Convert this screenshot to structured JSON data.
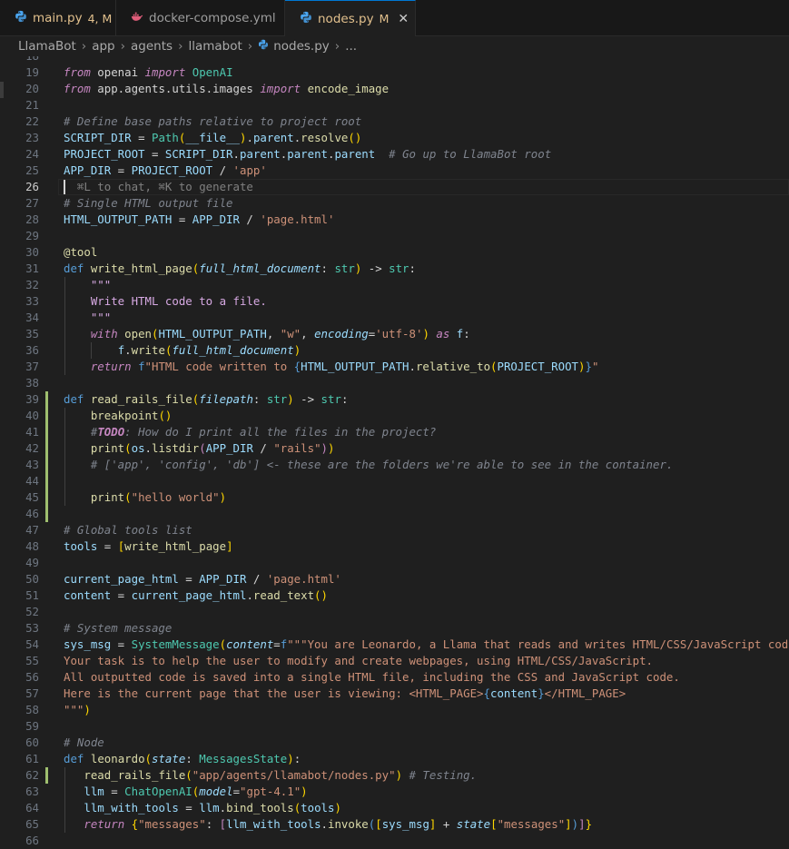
{
  "tabs": [
    {
      "name": "main.py",
      "badge": "4, M",
      "icon": "python-file-icon",
      "color": "#4aa5f0",
      "label_color": "#e2c08d",
      "active": false
    },
    {
      "name": "docker-compose.yml",
      "badge": "",
      "icon": "docker-file-icon",
      "color": "#e05d7a",
      "label_color": "#9d9d9d",
      "active": false
    },
    {
      "name": "nodes.py",
      "badge": "M",
      "icon": "python-file-icon",
      "color": "#4aa5f0",
      "label_color": "#e2c08d",
      "active": true
    }
  ],
  "breadcrumb": [
    "LlamaBot",
    "app",
    "agents",
    "llamabot",
    "nodes.py",
    "..."
  ],
  "current_line": "26",
  "hint_text": "⌘L to chat, ⌘K to generate",
  "lines": [
    {
      "n": "18",
      "tokens": []
    },
    {
      "n": "19",
      "tokens": [
        [
          "kw",
          "from"
        ],
        [
          "plain",
          " openai "
        ],
        [
          "kw",
          "import"
        ],
        [
          "plain",
          " "
        ],
        [
          "cls",
          "OpenAI"
        ]
      ]
    },
    {
      "n": "20",
      "tokens": [
        [
          "kw",
          "from"
        ],
        [
          "plain",
          " app.agents.utils.images "
        ],
        [
          "kw",
          "import"
        ],
        [
          "plain",
          " "
        ],
        [
          "fn",
          "encode_image"
        ]
      ]
    },
    {
      "n": "21",
      "tokens": []
    },
    {
      "n": "22",
      "tokens": [
        [
          "cmtg",
          "# Define base paths relative to project root"
        ]
      ]
    },
    {
      "n": "23",
      "tokens": [
        [
          "var",
          "SCRIPT_DIR"
        ],
        [
          "op",
          " = "
        ],
        [
          "cls",
          "Path"
        ],
        [
          "yellow",
          "("
        ],
        [
          "var",
          "__file__"
        ],
        [
          "yellow",
          ")"
        ],
        [
          "op",
          "."
        ],
        [
          "var",
          "parent"
        ],
        [
          "op",
          "."
        ],
        [
          "fn",
          "resolve"
        ],
        [
          "yellow",
          "()"
        ]
      ]
    },
    {
      "n": "24",
      "tokens": [
        [
          "var",
          "PROJECT_ROOT"
        ],
        [
          "op",
          " = "
        ],
        [
          "var",
          "SCRIPT_DIR"
        ],
        [
          "op",
          "."
        ],
        [
          "var",
          "parent"
        ],
        [
          "op",
          "."
        ],
        [
          "var",
          "parent"
        ],
        [
          "op",
          "."
        ],
        [
          "var",
          "parent"
        ],
        [
          "plain",
          "  "
        ],
        [
          "cmtg",
          "# Go up to LlamaBot root"
        ]
      ]
    },
    {
      "n": "25",
      "tokens": [
        [
          "var",
          "APP_DIR"
        ],
        [
          "op",
          " = "
        ],
        [
          "var",
          "PROJECT_ROOT"
        ],
        [
          "op",
          " / "
        ],
        [
          "str",
          "'app'"
        ]
      ]
    },
    {
      "n": "26",
      "tokens": [
        [
          "hint",
          "  ⌘L to chat, ⌘K to generate"
        ]
      ]
    },
    {
      "n": "27",
      "tokens": [
        [
          "cmtg",
          "# Single HTML output file"
        ]
      ]
    },
    {
      "n": "28",
      "tokens": [
        [
          "var",
          "HTML_OUTPUT_PATH"
        ],
        [
          "op",
          " = "
        ],
        [
          "var",
          "APP_DIR"
        ],
        [
          "op",
          " / "
        ],
        [
          "str",
          "'page.html'"
        ]
      ]
    },
    {
      "n": "29",
      "tokens": []
    },
    {
      "n": "30",
      "tokens": [
        [
          "dec",
          "@tool"
        ]
      ]
    },
    {
      "n": "31",
      "tokens": [
        [
          "kw2",
          "def"
        ],
        [
          "plain",
          " "
        ],
        [
          "fn",
          "write_html_page"
        ],
        [
          "yellow",
          "("
        ],
        [
          "param",
          "full_html_document"
        ],
        [
          "op",
          ": "
        ],
        [
          "bi",
          "str"
        ],
        [
          "yellow",
          ")"
        ],
        [
          "op",
          " -> "
        ],
        [
          "bi",
          "str"
        ],
        [
          "op",
          ":"
        ]
      ]
    },
    {
      "n": "32",
      "tokens": [
        [
          "plain",
          "    "
        ],
        [
          "strd",
          "\"\"\""
        ]
      ]
    },
    {
      "n": "33",
      "tokens": [
        [
          "plain",
          "    "
        ],
        [
          "strd",
          "Write HTML code to a file."
        ]
      ]
    },
    {
      "n": "34",
      "tokens": [
        [
          "plain",
          "    "
        ],
        [
          "strd",
          "\"\"\""
        ]
      ]
    },
    {
      "n": "35",
      "tokens": [
        [
          "plain",
          "    "
        ],
        [
          "kw",
          "with"
        ],
        [
          "plain",
          " "
        ],
        [
          "fn",
          "open"
        ],
        [
          "yellow",
          "("
        ],
        [
          "var",
          "HTML_OUTPUT_PATH"
        ],
        [
          "op",
          ", "
        ],
        [
          "str",
          "\"w\""
        ],
        [
          "op",
          ", "
        ],
        [
          "param",
          "encoding"
        ],
        [
          "op",
          "="
        ],
        [
          "str",
          "'utf-8'"
        ],
        [
          "yellow",
          ")"
        ],
        [
          "plain",
          " "
        ],
        [
          "kw",
          "as"
        ],
        [
          "plain",
          " "
        ],
        [
          "var",
          "f"
        ],
        [
          "op",
          ":"
        ]
      ]
    },
    {
      "n": "36",
      "tokens": [
        [
          "plain",
          "        "
        ],
        [
          "var",
          "f"
        ],
        [
          "op",
          "."
        ],
        [
          "fn",
          "write"
        ],
        [
          "yellow",
          "("
        ],
        [
          "param",
          "full_html_document"
        ],
        [
          "yellow",
          ")"
        ]
      ]
    },
    {
      "n": "37",
      "tokens": [
        [
          "plain",
          "    "
        ],
        [
          "kw",
          "return"
        ],
        [
          "plain",
          " "
        ],
        [
          "kw2",
          "f"
        ],
        [
          "str",
          "\"HTML code written to "
        ],
        [
          "kw2",
          "{"
        ],
        [
          "var",
          "HTML_OUTPUT_PATH"
        ],
        [
          "op",
          "."
        ],
        [
          "fn",
          "relative_to"
        ],
        [
          "yellow",
          "("
        ],
        [
          "var",
          "PROJECT_ROOT"
        ],
        [
          "yellow",
          ")"
        ],
        [
          "kw2",
          "}"
        ],
        [
          "str",
          "\""
        ]
      ]
    },
    {
      "n": "38",
      "tokens": []
    },
    {
      "n": "39",
      "tokens": [
        [
          "kw2",
          "def"
        ],
        [
          "plain",
          " "
        ],
        [
          "fn",
          "read_rails_file"
        ],
        [
          "yellow",
          "("
        ],
        [
          "param",
          "filepath"
        ],
        [
          "op",
          ": "
        ],
        [
          "bi",
          "str"
        ],
        [
          "yellow",
          ")"
        ],
        [
          "op",
          " -> "
        ],
        [
          "bi",
          "str"
        ],
        [
          "op",
          ":"
        ]
      ]
    },
    {
      "n": "40",
      "tokens": [
        [
          "plain",
          "    "
        ],
        [
          "fn",
          "breakpoint"
        ],
        [
          "yellow",
          "()"
        ]
      ]
    },
    {
      "n": "41",
      "tokens": [
        [
          "plain",
          "    "
        ],
        [
          "cmtg",
          "#"
        ],
        [
          "todo",
          "TODO"
        ],
        [
          "cmtg",
          ": How do I print all the files in the project?"
        ]
      ]
    },
    {
      "n": "42",
      "tokens": [
        [
          "plain",
          "    "
        ],
        [
          "fn",
          "print"
        ],
        [
          "yellow",
          "("
        ],
        [
          "var",
          "os"
        ],
        [
          "op",
          "."
        ],
        [
          "fn",
          "listdir"
        ],
        [
          "purple",
          "("
        ],
        [
          "var",
          "APP_DIR"
        ],
        [
          "op",
          " / "
        ],
        [
          "str",
          "\"rails\""
        ],
        [
          "purple",
          ")"
        ],
        [
          "yellow",
          ")"
        ]
      ]
    },
    {
      "n": "43",
      "tokens": [
        [
          "plain",
          "    "
        ],
        [
          "cmtg",
          "# ['app', 'config', 'db'] <- these are the folders we're able to see in the container."
        ]
      ]
    },
    {
      "n": "44",
      "tokens": []
    },
    {
      "n": "45",
      "tokens": [
        [
          "plain",
          "    "
        ],
        [
          "fn",
          "print"
        ],
        [
          "yellow",
          "("
        ],
        [
          "str",
          "\"hello world\""
        ],
        [
          "yellow",
          ")"
        ]
      ]
    },
    {
      "n": "46",
      "tokens": []
    },
    {
      "n": "47",
      "tokens": [
        [
          "cmtg",
          "# Global tools list"
        ]
      ]
    },
    {
      "n": "48",
      "tokens": [
        [
          "var",
          "tools"
        ],
        [
          "op",
          " = "
        ],
        [
          "yellow",
          "["
        ],
        [
          "fn",
          "write_html_page"
        ],
        [
          "yellow",
          "]"
        ]
      ]
    },
    {
      "n": "49",
      "tokens": []
    },
    {
      "n": "50",
      "tokens": [
        [
          "var",
          "current_page_html"
        ],
        [
          "op",
          " = "
        ],
        [
          "var",
          "APP_DIR"
        ],
        [
          "op",
          " / "
        ],
        [
          "str",
          "'page.html'"
        ]
      ]
    },
    {
      "n": "51",
      "tokens": [
        [
          "var",
          "content"
        ],
        [
          "op",
          " = "
        ],
        [
          "var",
          "current_page_html"
        ],
        [
          "op",
          "."
        ],
        [
          "fn",
          "read_text"
        ],
        [
          "yellow",
          "()"
        ]
      ]
    },
    {
      "n": "52",
      "tokens": []
    },
    {
      "n": "53",
      "tokens": [
        [
          "cmtg",
          "# System message"
        ]
      ]
    },
    {
      "n": "54",
      "tokens": [
        [
          "var",
          "sys_msg"
        ],
        [
          "op",
          " = "
        ],
        [
          "cls",
          "SystemMessage"
        ],
        [
          "yellow",
          "("
        ],
        [
          "param",
          "content"
        ],
        [
          "op",
          "="
        ],
        [
          "kw2",
          "f"
        ],
        [
          "str",
          "\"\"\"You are Leonardo, a Llama that reads and writes HTML/CSS/JavaScript code."
        ]
      ]
    },
    {
      "n": "55",
      "tokens": [
        [
          "str",
          "Your task is to help the user to modify and create webpages, using HTML/CSS/JavaScript."
        ]
      ]
    },
    {
      "n": "56",
      "tokens": [
        [
          "str",
          "All outputted code is saved into a single HTML file, including the CSS and JavaScript code."
        ]
      ]
    },
    {
      "n": "57",
      "tokens": [
        [
          "str",
          "Here is the current page that the user is viewing: <HTML_PAGE>"
        ],
        [
          "kw2",
          "{"
        ],
        [
          "var",
          "content"
        ],
        [
          "kw2",
          "}"
        ],
        [
          "str",
          "</HTML_PAGE>"
        ]
      ]
    },
    {
      "n": "58",
      "tokens": [
        [
          "str",
          "\"\"\""
        ],
        [
          "yellow",
          ")"
        ]
      ]
    },
    {
      "n": "59",
      "tokens": []
    },
    {
      "n": "60",
      "tokens": [
        [
          "cmtg",
          "# Node"
        ]
      ]
    },
    {
      "n": "61",
      "tokens": [
        [
          "kw2",
          "def"
        ],
        [
          "plain",
          " "
        ],
        [
          "fn",
          "leonardo"
        ],
        [
          "yellow",
          "("
        ],
        [
          "param",
          "state"
        ],
        [
          "op",
          ": "
        ],
        [
          "cls",
          "MessagesState"
        ],
        [
          "yellow",
          ")"
        ],
        [
          "op",
          ":"
        ]
      ]
    },
    {
      "n": "62",
      "tokens": [
        [
          "plain",
          "   "
        ],
        [
          "fn",
          "read_rails_file"
        ],
        [
          "yellow",
          "("
        ],
        [
          "str",
          "\"app/agents/llamabot/nodes.py\""
        ],
        [
          "yellow",
          ")"
        ],
        [
          "plain",
          " "
        ],
        [
          "cmtg",
          "# Testing."
        ]
      ]
    },
    {
      "n": "63",
      "tokens": [
        [
          "plain",
          "   "
        ],
        [
          "var",
          "llm"
        ],
        [
          "op",
          " = "
        ],
        [
          "cls",
          "ChatOpenAI"
        ],
        [
          "yellow",
          "("
        ],
        [
          "param",
          "model"
        ],
        [
          "op",
          "="
        ],
        [
          "str",
          "\"gpt-4.1\""
        ],
        [
          "yellow",
          ")"
        ]
      ]
    },
    {
      "n": "64",
      "tokens": [
        [
          "plain",
          "   "
        ],
        [
          "var",
          "llm_with_tools"
        ],
        [
          "op",
          " = "
        ],
        [
          "var",
          "llm"
        ],
        [
          "op",
          "."
        ],
        [
          "fn",
          "bind_tools"
        ],
        [
          "yellow",
          "("
        ],
        [
          "var",
          "tools"
        ],
        [
          "yellow",
          ")"
        ]
      ]
    },
    {
      "n": "65",
      "tokens": [
        [
          "plain",
          "   "
        ],
        [
          "kw",
          "return"
        ],
        [
          "plain",
          " "
        ],
        [
          "yellow",
          "{"
        ],
        [
          "str",
          "\"messages\""
        ],
        [
          "op",
          ": "
        ],
        [
          "purple",
          "["
        ],
        [
          "var",
          "llm_with_tools"
        ],
        [
          "op",
          "."
        ],
        [
          "fn",
          "invoke"
        ],
        [
          "kw2",
          "("
        ],
        [
          "yellow",
          "["
        ],
        [
          "var",
          "sys_msg"
        ],
        [
          "yellow",
          "]"
        ],
        [
          "op",
          " + "
        ],
        [
          "param",
          "state"
        ],
        [
          "yellow",
          "["
        ],
        [
          "str",
          "\"messages\""
        ],
        [
          "yellow",
          "]"
        ],
        [
          "kw2",
          ")"
        ],
        [
          "purple",
          "]"
        ],
        [
          "yellow",
          "}"
        ]
      ]
    },
    {
      "n": "66",
      "tokens": []
    }
  ],
  "colors": {
    "accent": "#0078d4",
    "modified": "#e2c08d",
    "git_added": "#2ea043"
  }
}
